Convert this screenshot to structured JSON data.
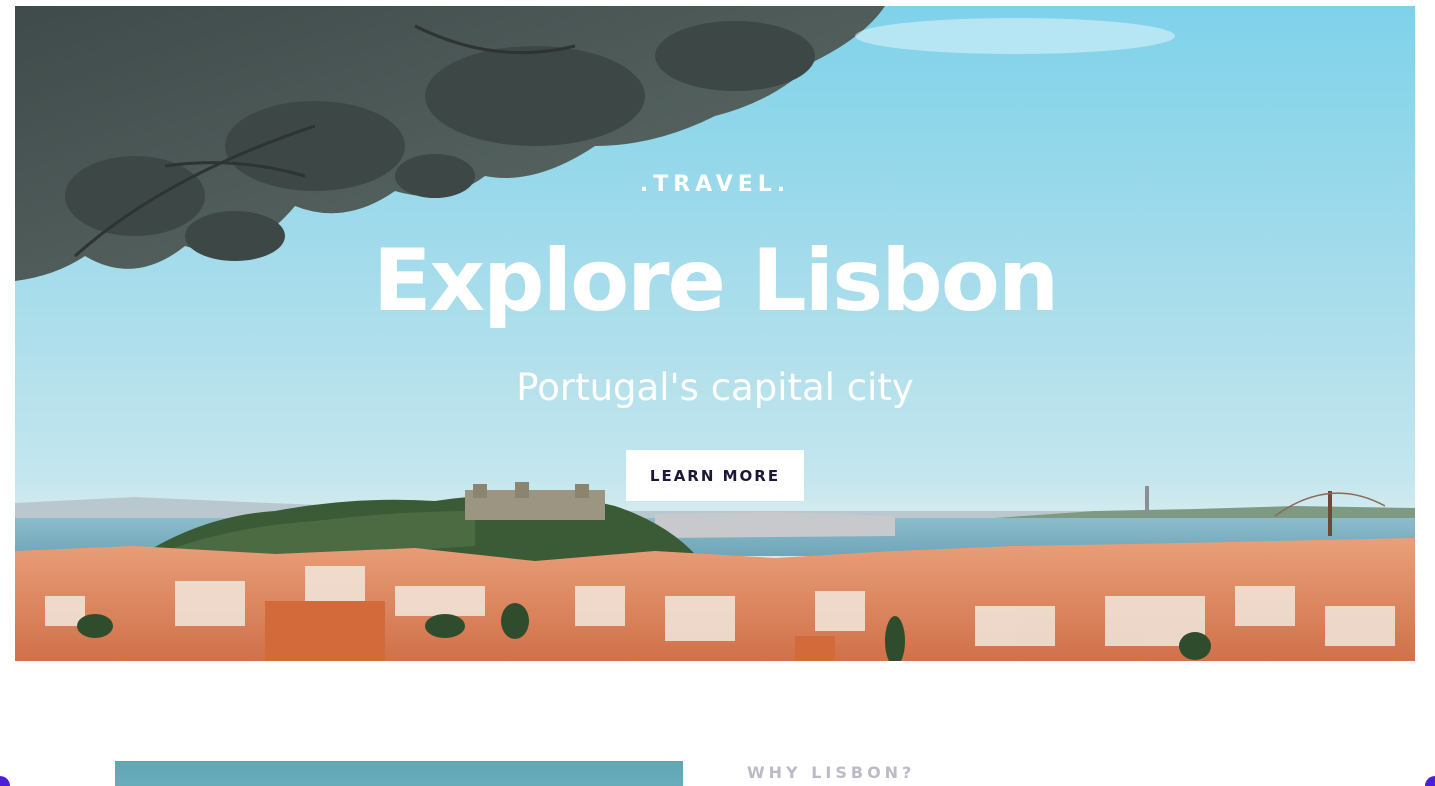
{
  "hero": {
    "eyebrow": ".TRAVEL.",
    "title": "Explore Lisbon",
    "subtitle": "Portugal's capital city",
    "cta_label": "LEARN MORE"
  },
  "intro": {
    "eyebrow": "WHY LISBON?"
  },
  "colors": {
    "cta_text": "#1c1838",
    "eyebrow_muted": "#bdbac8",
    "accent": "#4b1fd6"
  }
}
